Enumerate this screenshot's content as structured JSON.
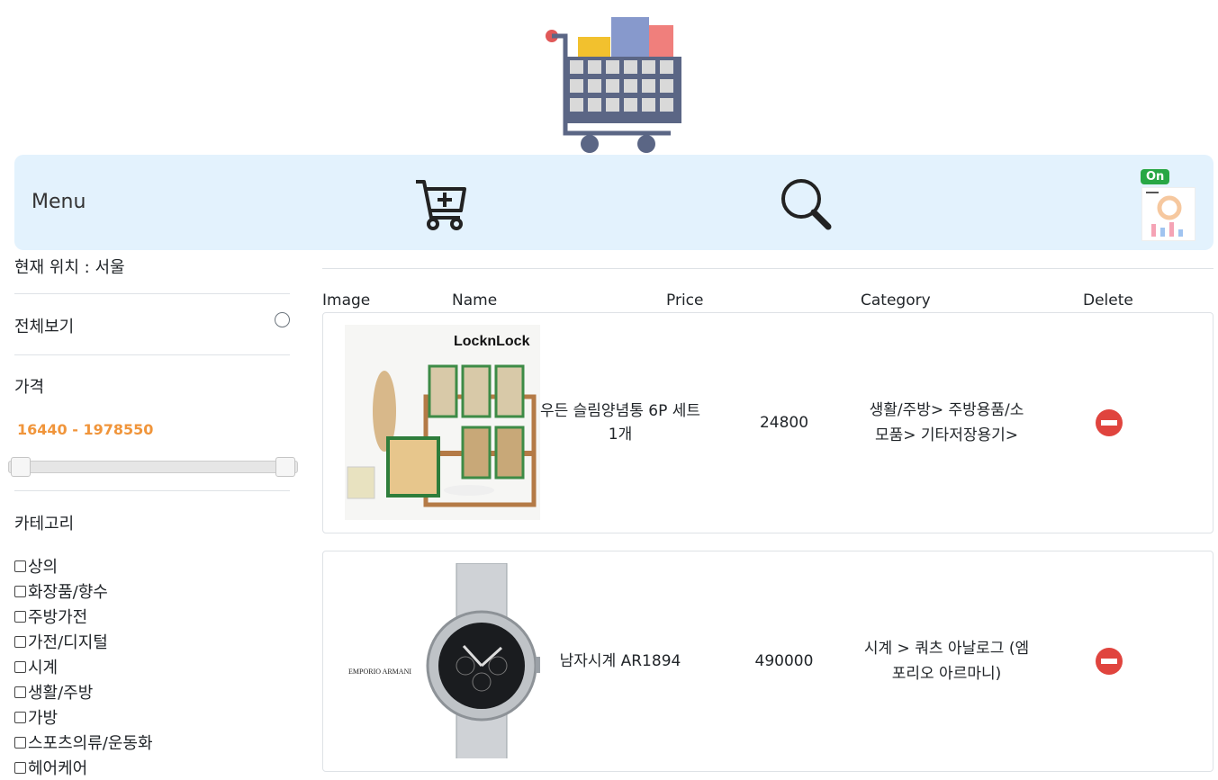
{
  "nav": {
    "menu_label": "Menu",
    "badge": "On"
  },
  "sidebar": {
    "location": "현재 위치 : 서울",
    "all_label": "전체보기",
    "price_label": "가격",
    "price_range": "16440 - 1978550",
    "category_label": "카테고리",
    "categories": [
      "상의",
      "화장품/향수",
      "주방가전",
      "가전/디지털",
      "시계",
      "생활/주방",
      "가방",
      "스포츠의류/운동화",
      "헤어케어"
    ]
  },
  "table": {
    "headers": [
      "Image",
      "Name",
      "Price",
      "Category",
      "Delete"
    ],
    "rows": [
      {
        "brand": "LocknLock",
        "name": "우든 슬림양념통 6P 세트 1개",
        "price": "24800",
        "category": "생활/주방> 주방용품/소모품> 기타저장용기>"
      },
      {
        "brand": "EMPORIO ARMANI",
        "name": "남자시계 AR1894",
        "price": "490000",
        "category": "시계 > 쿼츠 아날로그 (엠포리오 아르마니)"
      }
    ]
  },
  "colors": {
    "navbar_bg": "#e3f2fd",
    "price_range": "#f0953b",
    "delete": "#e0443e",
    "badge": "#28a745"
  },
  "icons": [
    "shopping-cart-logo-icon",
    "cart-add-icon",
    "search-icon",
    "minus-circle-icon"
  ]
}
